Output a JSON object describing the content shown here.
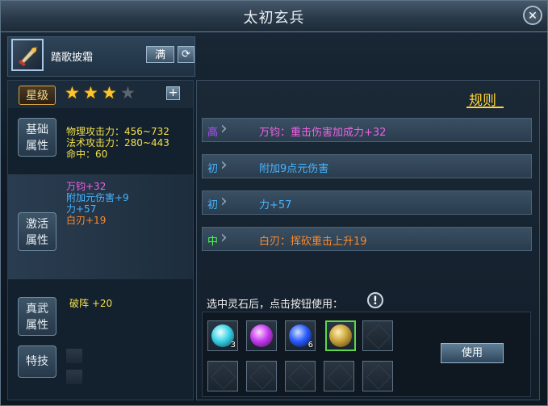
{
  "window": {
    "title": "太初玄兵",
    "close_icon": "close-icon"
  },
  "item": {
    "name": "踏歌披霜",
    "max_label": "满",
    "refresh_icon": "refresh-icon"
  },
  "star": {
    "label": "星级",
    "filled": 3,
    "total": 4,
    "plus_label": "+"
  },
  "basic": {
    "label_top": "基础",
    "label_bottom": "属性",
    "lines": [
      "物理攻击力：456~732",
      "法术攻击力：280~443",
      "命中：60"
    ]
  },
  "activate": {
    "label_top": "激活",
    "label_bottom": "属性",
    "lines": [
      "万钧+32",
      "附加元伤害+9",
      "力+57",
      "白刃+19"
    ]
  },
  "zhenwu": {
    "label_top": "真武",
    "label_bottom": "属性",
    "value": "破阵  +20"
  },
  "special": {
    "label": "特技"
  },
  "rules": {
    "title": "规则",
    "rows": [
      {
        "grade": "高",
        "text": "万钧：重击伤害加成力+32",
        "grade_color": "#b74cff",
        "text_color": "#f061e6"
      },
      {
        "grade": "初",
        "text": "附加9点元伤害",
        "grade_color": "#46b4ff",
        "text_color": "#46b4ff"
      },
      {
        "grade": "初",
        "text": "力+57",
        "grade_color": "#46b4ff",
        "text_color": "#46b4ff"
      },
      {
        "grade": "中",
        "text": "白刃：挥砍重击上升19",
        "grade_color": "#4cff4c",
        "text_color": "#ff8a2a"
      }
    ]
  },
  "gems": {
    "hint": "选中灵石后，点击按钮使用：",
    "info_label": "!",
    "slots": [
      {
        "gem": "cyan-gem-icon",
        "color": "#38d2e6",
        "count": "3"
      },
      {
        "gem": "purple-gem-icon",
        "color": "#c43cf0",
        "count": ""
      },
      {
        "gem": "blue-gem-icon",
        "color": "#2a5cff",
        "count": "6"
      },
      {
        "gem": "gold-gem-icon",
        "color": "#c9a23a",
        "count": ""
      },
      {
        "gem": "",
        "color": "",
        "count": ""
      }
    ],
    "use_label": "使用"
  }
}
